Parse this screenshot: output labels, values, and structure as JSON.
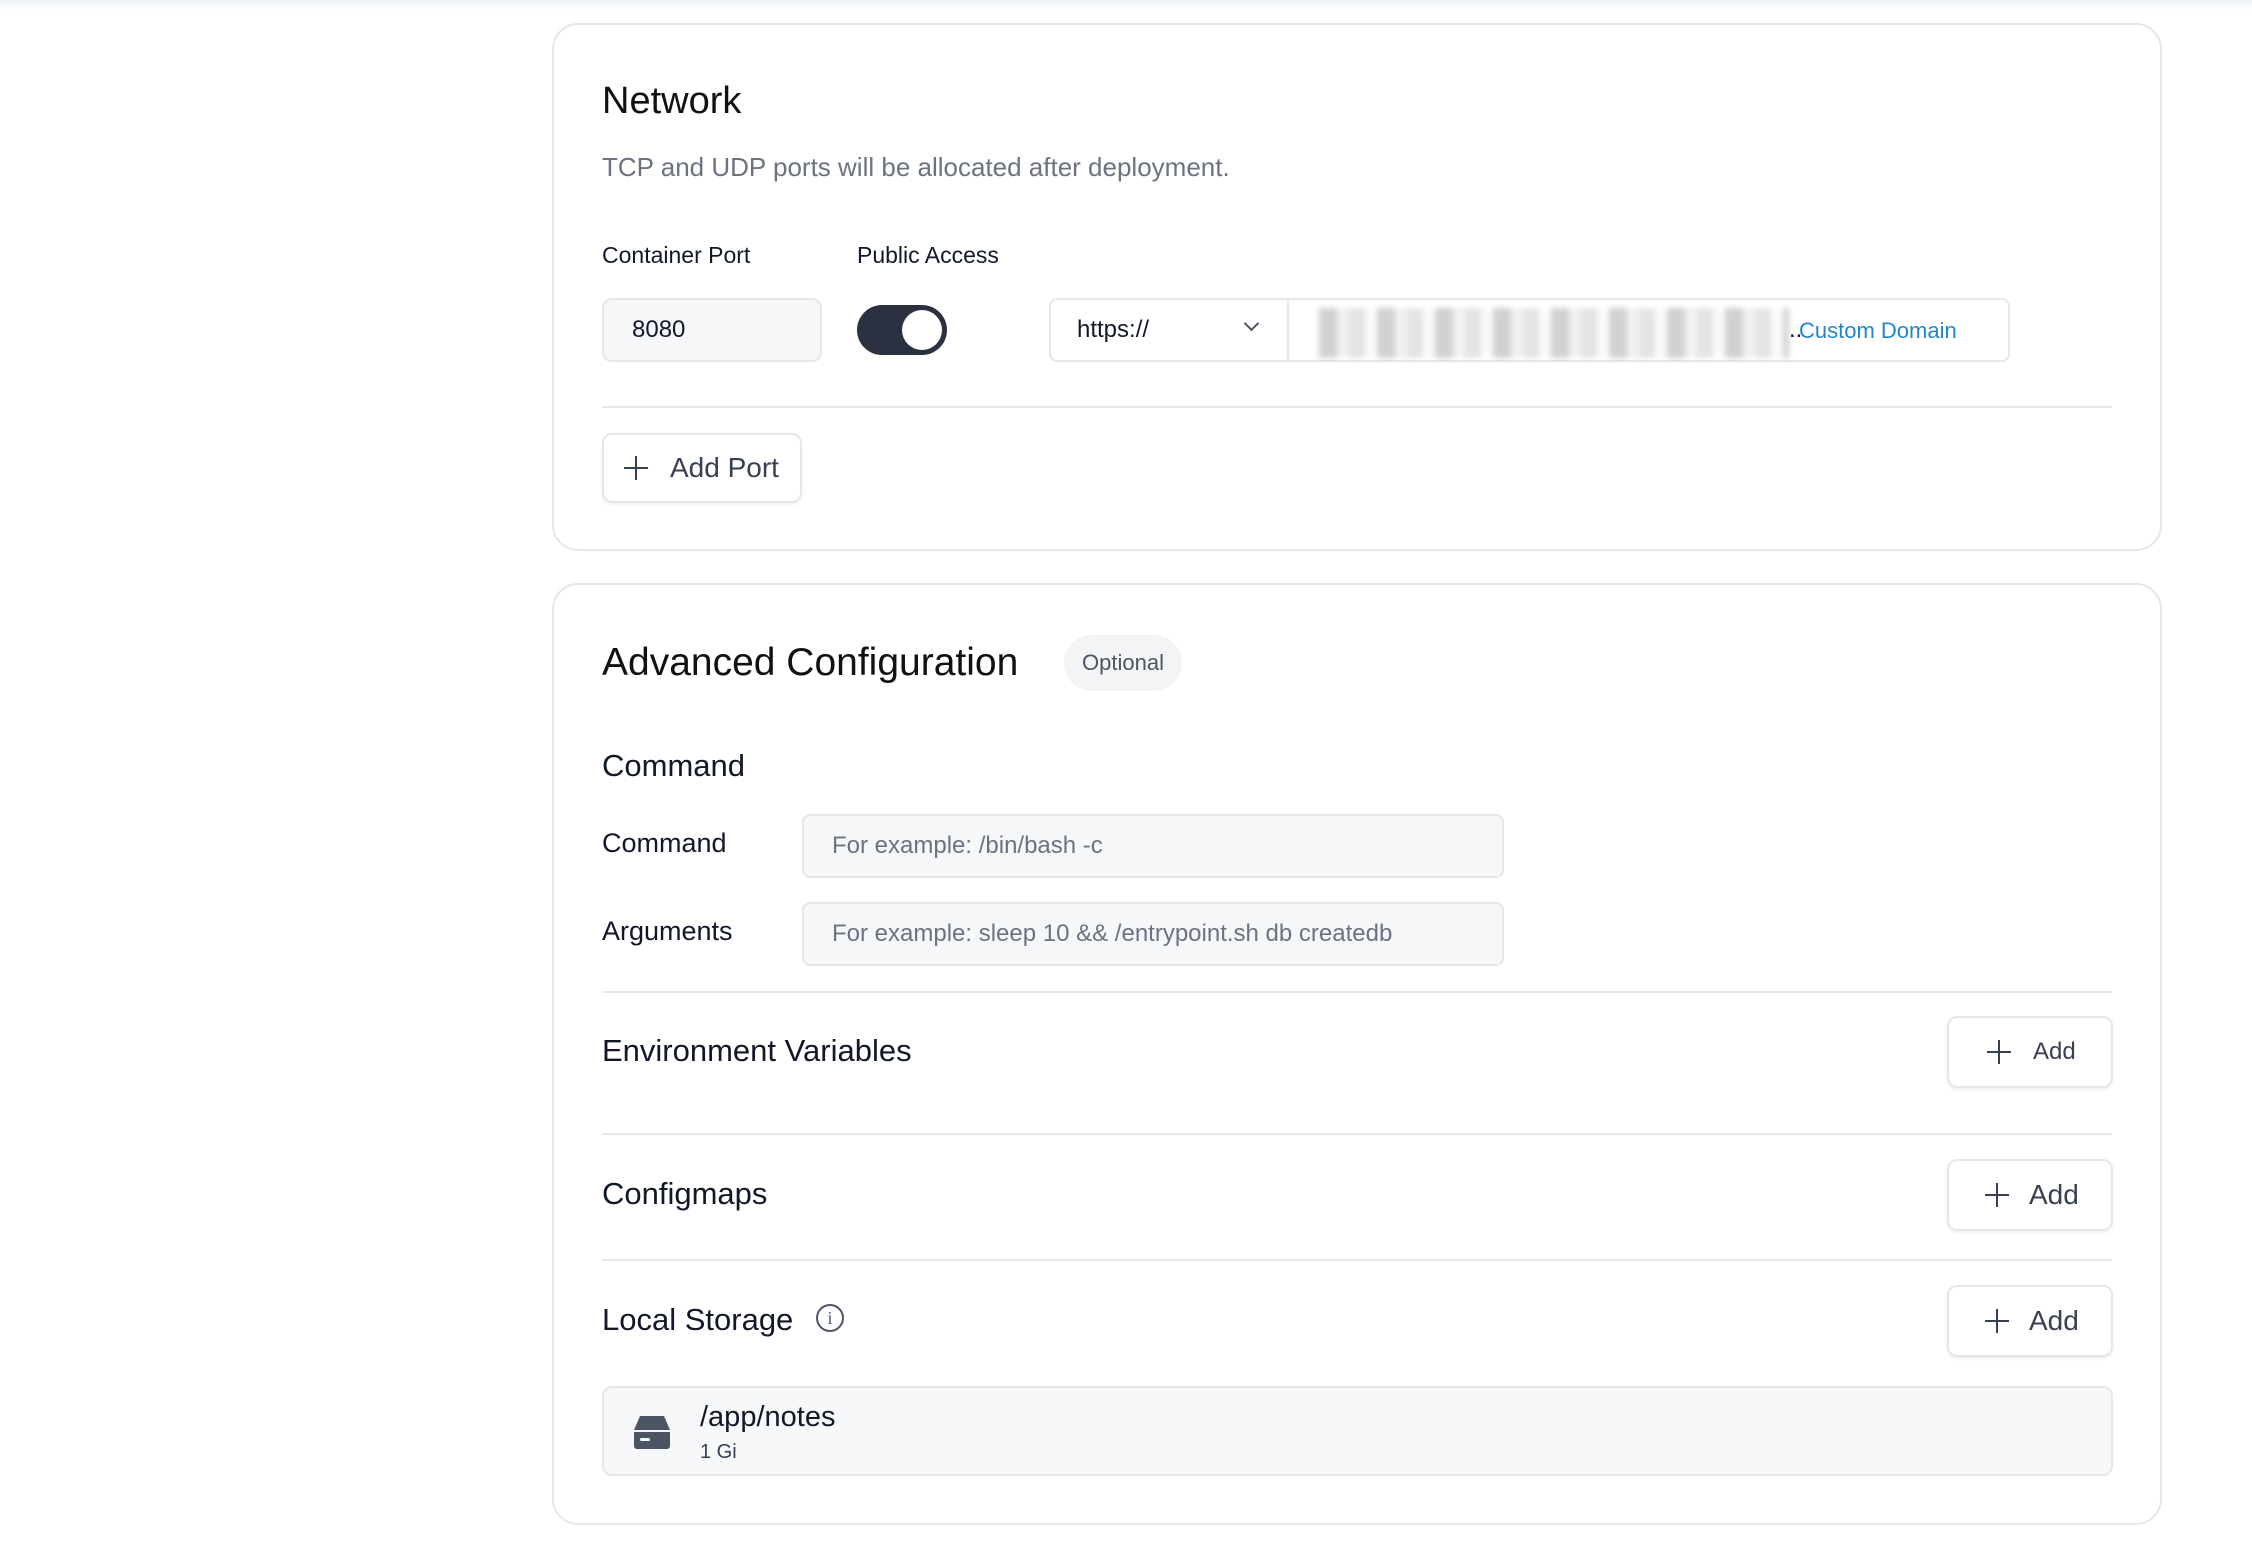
{
  "network": {
    "title": "Network",
    "subtitle": "TCP and UDP ports will be allocated after deployment.",
    "container_port_label": "Container Port",
    "public_access_label": "Public Access",
    "port_value": "8080",
    "public_access_enabled": true,
    "protocol_selected": "https://",
    "domain_suffix": "..",
    "custom_domain_label": "Custom Domain",
    "add_port_label": "Add Port"
  },
  "advanced": {
    "title": "Advanced Configuration",
    "badge": "Optional",
    "command_section": {
      "title": "Command",
      "command_label": "Command",
      "command_placeholder": "For example:  /bin/bash -c",
      "arguments_label": "Arguments",
      "arguments_placeholder": "For example:  sleep 10 && /entrypoint.sh db createdb"
    },
    "env_vars": {
      "title": "Environment Variables",
      "add_label": "Add"
    },
    "configmaps": {
      "title": "Configmaps",
      "add_label": "Add"
    },
    "local_storage": {
      "title": "Local Storage",
      "info_glyph": "i",
      "add_label": "Add",
      "items": [
        {
          "path": "/app/notes",
          "size": "1 Gi"
        }
      ]
    }
  },
  "icons": {
    "plus": "plus-icon",
    "chevron": "chevron-down-icon",
    "info": "info-icon",
    "storage": "hard-drive-icon"
  },
  "colors": {
    "toggle_on": "#2b3140",
    "link": "#1e86c9",
    "border": "#e5e7eb",
    "input_bg": "#f6f7f9"
  }
}
